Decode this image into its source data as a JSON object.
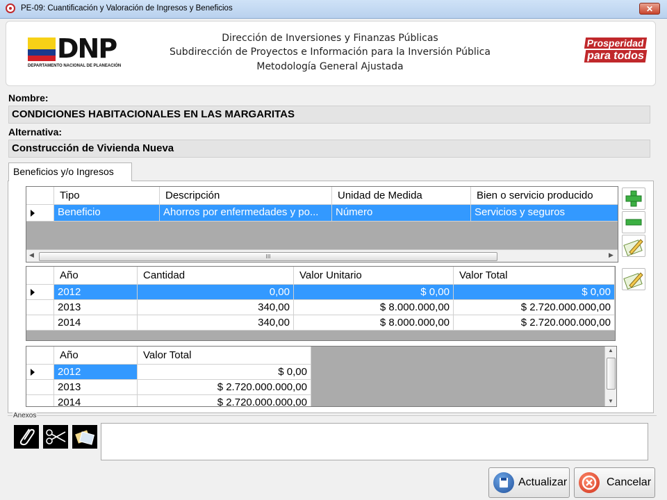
{
  "window": {
    "title": "PE-09: Cuantificación y Valoración de Ingresos y Beneficios",
    "close_label": "✕"
  },
  "header": {
    "line1": "Dirección de Inversiones y Finanzas Públicas",
    "line2": "Subdirección de Proyectos e Información para la Inversión Pública",
    "line3": "Metodología General Ajustada",
    "logo_text": "DNP",
    "logo_subtext": "DEPARTAMENTO NACIONAL DE PLANEACIÓN",
    "slogan_line1": "Prosperidad",
    "slogan_line2": "para todos"
  },
  "form": {
    "nombre_label": "Nombre:",
    "nombre_value": "CONDICIONES HABITACIONALES EN LAS MARGARITAS",
    "alternativa_label": "Alternativa:",
    "alternativa_value": "Construcción de Vivienda Nueva"
  },
  "tab": {
    "label": "Beneficios y/o Ingresos"
  },
  "grid1": {
    "headers": [
      "Tipo",
      "Descripción",
      "Unidad de Medida",
      "Bien o servicio producido"
    ],
    "rows": [
      [
        "Beneficio",
        "Ahorros por enfermedades y po...",
        "Número",
        "Servicios y seguros"
      ]
    ],
    "scroll_thumb": "III"
  },
  "grid2": {
    "headers": [
      "Año",
      "Cantidad",
      "Valor Unitario",
      "Valor Total"
    ],
    "rows": [
      [
        "2012",
        "0,00",
        "$ 0,00",
        "$ 0,00"
      ],
      [
        "2013",
        "340,00",
        "$ 8.000.000,00",
        "$ 2.720.000.000,00"
      ],
      [
        "2014",
        "340,00",
        "$ 8.000.000,00",
        "$ 2.720.000.000,00"
      ]
    ]
  },
  "grid3": {
    "headers": [
      "Año",
      "Valor Total"
    ],
    "rows": [
      [
        "2012",
        "$ 0,00"
      ],
      [
        "2013",
        "$ 2.720.000.000,00"
      ],
      [
        "2014",
        "$ 2.720.000.000,00"
      ]
    ]
  },
  "annex": {
    "label": "Anexos",
    "text_value": ""
  },
  "buttons": {
    "update": "Actualizar",
    "cancel": "Cancelar"
  },
  "colors": {
    "selection": "#3399ff",
    "grid_bg": "#ababab",
    "accent_red": "#c0282b",
    "add_green": "#3cb043"
  }
}
